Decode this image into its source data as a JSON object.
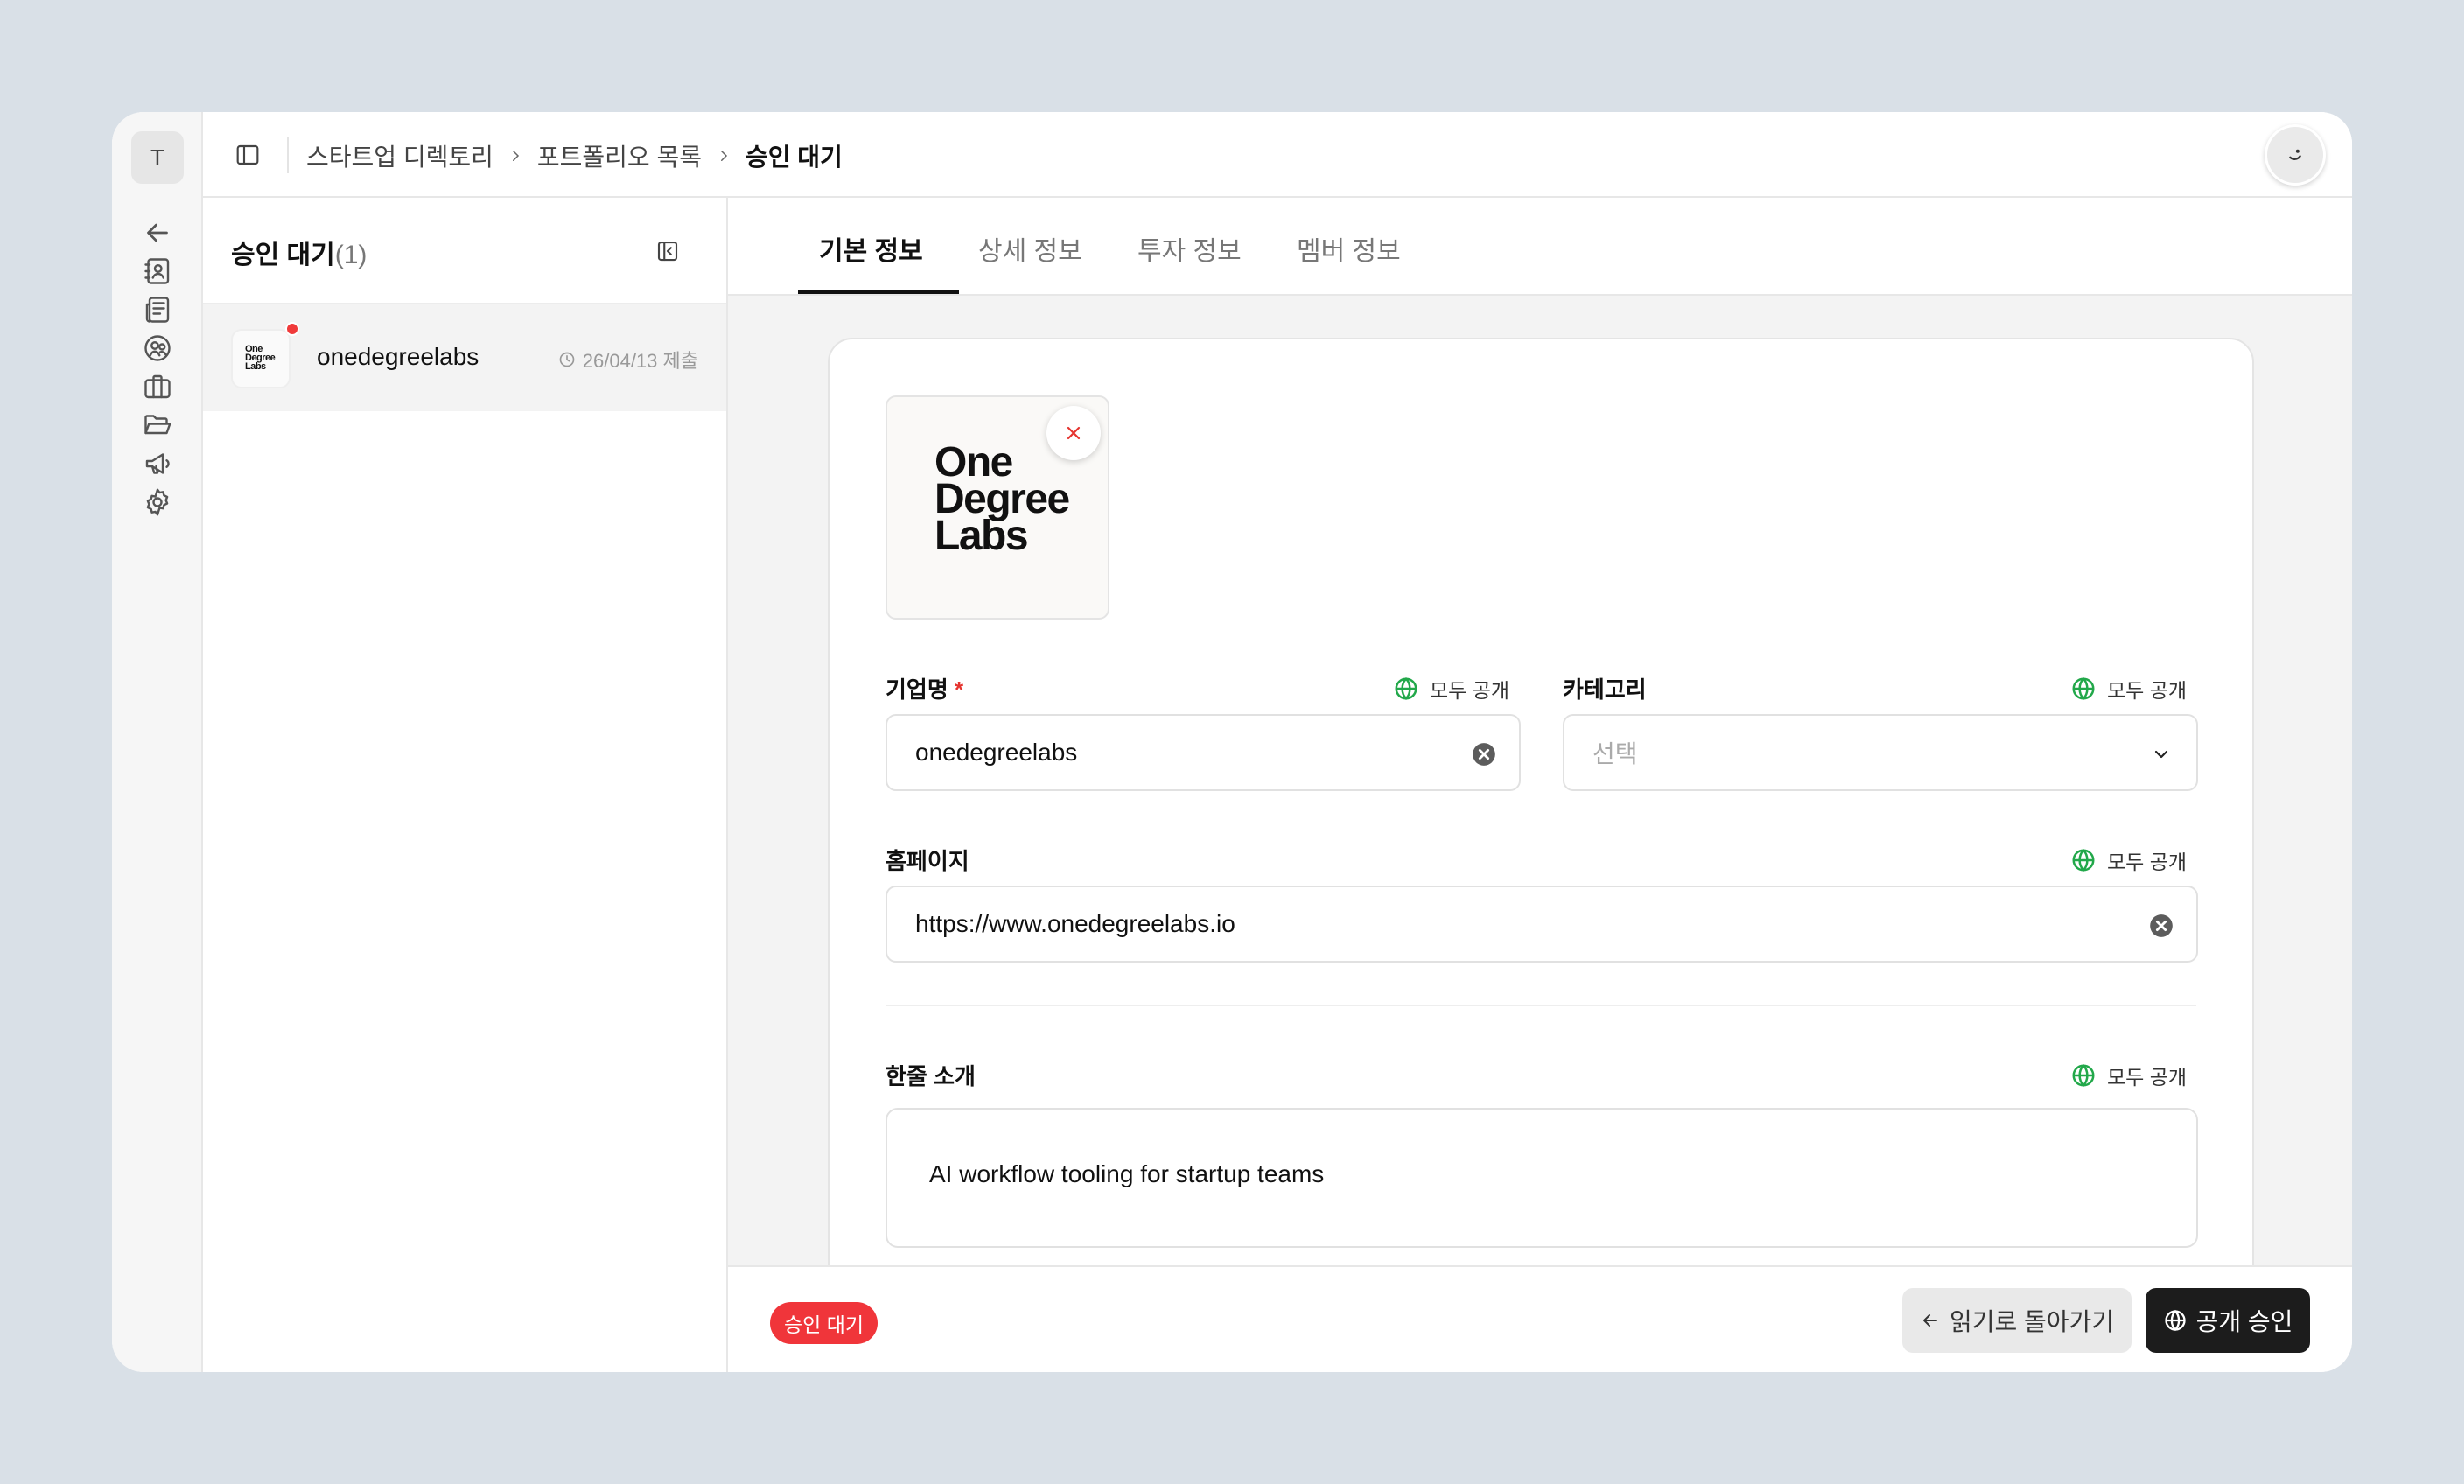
{
  "workspace": {
    "initial": "T"
  },
  "rail": {
    "icons": [
      "back-arrow-icon",
      "contact-book-icon",
      "newspaper-icon",
      "users-icon",
      "briefcase-icon",
      "folder-open-icon",
      "megaphone-icon",
      "settings-gear-icon"
    ]
  },
  "breadcrumb": {
    "items": [
      "스타트업 디렉토리",
      "포트폴리오 목록",
      "승인 대기"
    ]
  },
  "list": {
    "title": "승인 대기",
    "count": "(1)",
    "items": [
      {
        "logo_text": "One Degree Labs",
        "name": "onedegreelabs",
        "date": "26/04/13 제출"
      }
    ]
  },
  "tabs": [
    "기본 정보",
    "상세 정보",
    "투자 정보",
    "멤버 정보"
  ],
  "form": {
    "logo_text": "One Degree Labs",
    "company_name": {
      "label": "기업명",
      "required_mark": "*",
      "visibility": "모두 공개",
      "value": "onedegreelabs"
    },
    "category": {
      "label": "카테고리",
      "visibility": "모두 공개",
      "placeholder": "선택"
    },
    "homepage": {
      "label": "홈페이지",
      "visibility": "모두 공개",
      "value": "https://www.onedegreelabs.io"
    },
    "tagline": {
      "label": "한줄 소개",
      "visibility": "모두 공개",
      "value": "AI workflow tooling for startup teams"
    }
  },
  "footer": {
    "status": "승인 대기",
    "back_label": "읽기로 돌아가기",
    "approve_label": "공개 승인"
  },
  "colors": {
    "status": "#f0353a",
    "public_icon": "#22a84a",
    "primary_button": "#1c1c1c"
  }
}
